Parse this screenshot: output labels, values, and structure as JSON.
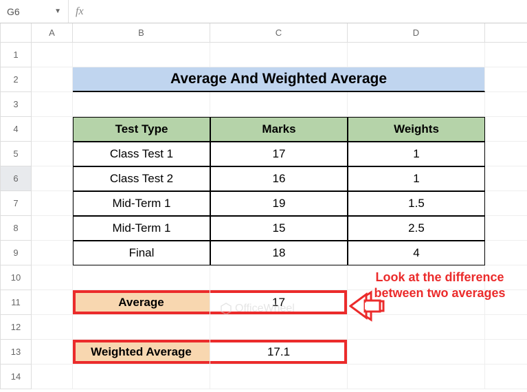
{
  "name_box": "G6",
  "columns": [
    "A",
    "B",
    "C",
    "D"
  ],
  "rows": [
    "1",
    "2",
    "3",
    "4",
    "5",
    "6",
    "7",
    "8",
    "9",
    "10",
    "11",
    "12",
    "13",
    "14"
  ],
  "title": "Average And Weighted Average",
  "table": {
    "headers": [
      "Test Type",
      "Marks",
      "Weights"
    ],
    "rows": [
      {
        "type": "Class Test 1",
        "marks": "17",
        "weights": "1"
      },
      {
        "type": "Class Test 2",
        "marks": "16",
        "weights": "1"
      },
      {
        "type": "Mid-Term 1",
        "marks": "19",
        "weights": "1.5"
      },
      {
        "type": "Mid-Term 1",
        "marks": "15",
        "weights": "2.5"
      },
      {
        "type": "Final",
        "marks": "18",
        "weights": "4"
      }
    ]
  },
  "avg": {
    "label": "Average",
    "value": "17"
  },
  "wavg": {
    "label": "Weighted Average",
    "value": "17.1"
  },
  "callout": "Look at the difference between two averages",
  "watermark": "OfficeWheel"
}
